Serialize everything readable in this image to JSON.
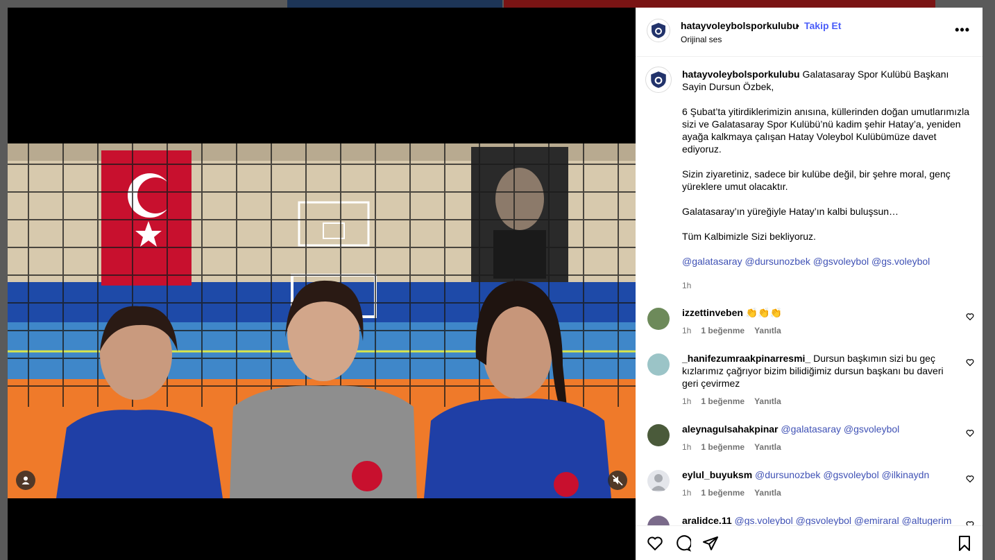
{
  "header": {
    "username": "hatayvoleybolsporkulubu",
    "separator": "•",
    "follow_label": "Takip Et",
    "audio_label": "Orijinal ses",
    "more_label": "•••"
  },
  "caption": {
    "username": "hatayvoleybolsporkulubu",
    "first_line": "Galatasaray Spor Kulübü Başkanı Sayin Dursun Özbek,",
    "paragraphs": [
      "6 Şubat’ta yitirdiklerimizin anısına, küllerinden doğan umutlarımızla sizi ve Galatasaray Spor Kulübü’nü kadim şehir Hatay’a, yeniden ayağa kalkmaya çalışan Hatay Voleybol Kulübümüze davet ediyoruz.",
      "Sizin ziyaretiniz, sadece bir kulübe değil, bir şehre moral, genç yüreklere umut olacaktır.",
      "Galatasaray’ın yüreğiyle Hatay’ın kalbi buluşsun…",
      "Tüm Kalbimizle Sizi bekliyoruz."
    ],
    "mentions": "@galatasaray @dursunozbek @gsvoleybol @gs.voleybol",
    "time": "1h"
  },
  "comments": [
    {
      "username": "izzettinveben",
      "text": "👏👏👏",
      "time": "1h",
      "likes": "1 beğenme",
      "reply": "Yanıtla",
      "mention": false
    },
    {
      "username": "_hanifezumraakpinarresmi_",
      "text": "Dursun başkımın sizi bu geç kızlarımız çağrıyor bizim bilidiğimiz dursun başkanı bu daveri geri çevirmez",
      "time": "1h",
      "likes": "1 beğenme",
      "reply": "Yanıtla",
      "mention": false
    },
    {
      "username": "aleynagulsahakpinar",
      "text": "@galatasaray @gsvoleybol",
      "time": "1h",
      "likes": "1 beğenme",
      "reply": "Yanıtla",
      "mention": true
    },
    {
      "username": "eylul_buyuksm",
      "text": "@dursunozbek @gsvoleybol @ilkinaydn",
      "time": "1h",
      "likes": "1 beğenme",
      "reply": "Yanıtla",
      "mention": true
    },
    {
      "username": "aralidce.11",
      "text": "@gs.voleybol @gsvoleybol @emiraral @altugerim @dinleryakup",
      "time": "",
      "likes": "",
      "reply": "",
      "mention": true
    }
  ],
  "icons": {
    "like": "heart-icon",
    "comment": "comment-icon",
    "share": "share-icon",
    "save": "bookmark-icon",
    "mute": "muted-speaker-icon",
    "tags": "user-tag-icon"
  },
  "colors": {
    "accent": "#4a5df9",
    "mention": "#3f51b5",
    "muted_text": "#737373"
  }
}
